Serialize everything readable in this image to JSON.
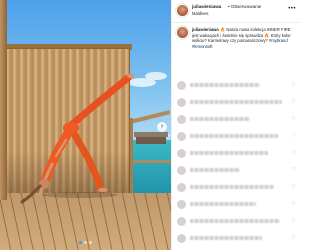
{
  "post": {
    "username": "juliawieniawa",
    "follow_label": "• Obserwowanie",
    "location": "Maldives",
    "more_icon": "ellipsis-icon",
    "caption": {
      "username": "juliawieniawa",
      "text": "🔥 Nasza nowa kolekcja INNER FIRE jest wakacjach i świetnie się sprawdza 🔥 Który kolor wolicie? Karmelowy czy pomarańczowy?",
      "hashtags": "#mybrand #lemonsoft"
    },
    "comment_count_visible": 10,
    "comment_like_icon": "heart-outline-icon"
  },
  "photo": {
    "next_icon": "chevron-right-icon",
    "slides_total": 3,
    "active_slide": 1
  },
  "colors": {
    "link_blue": "#00376b",
    "text": "#262626",
    "divider": "#efefef",
    "active_dot": "#3d9ae8"
  }
}
